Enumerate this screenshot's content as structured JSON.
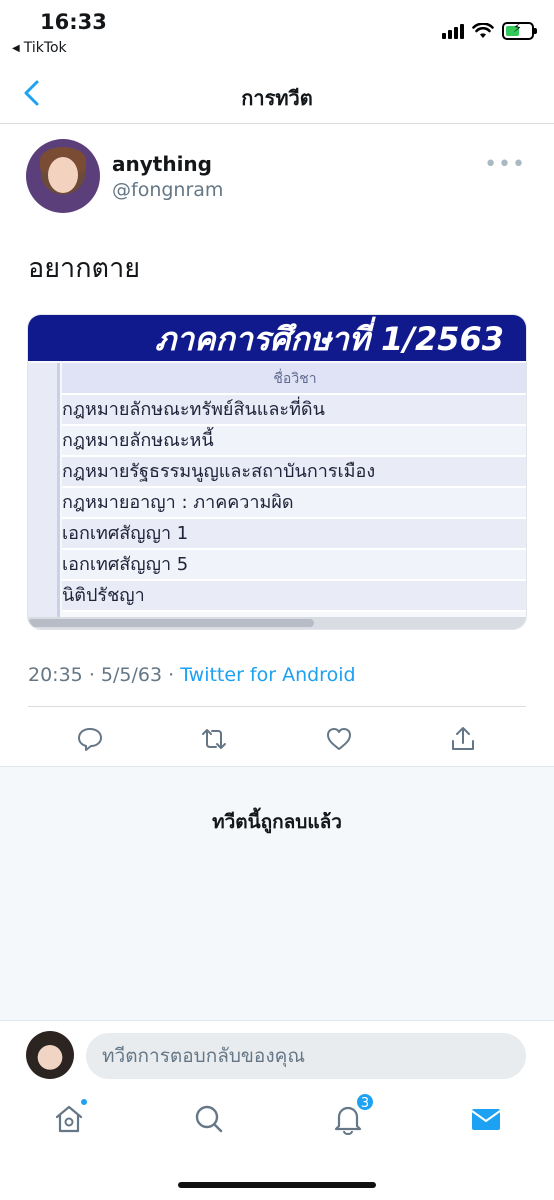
{
  "status_bar": {
    "time": "16:33",
    "back_app": "TikTok",
    "icons": [
      "cellular-signal-icon",
      "wifi-icon",
      "battery-charging-icon"
    ]
  },
  "header": {
    "title": "การทวีต",
    "back_icon": "chevron-left-icon"
  },
  "tweet": {
    "display_name": "anything",
    "handle": "@fongnram",
    "more_icon": "more-dots-icon",
    "text": "อยากตาย",
    "image": {
      "banner": "ภาคการศึกษาที่ 1/2563",
      "column_header": "ชื่อวิชา",
      "rows": [
        "กฎหมายลักษณะทรัพย์สินและที่ดิน",
        "กฎหมายลักษณะหนี้",
        "กฎหมายรัฐธรรมนูญและสถาบันการเมือง",
        "กฎหมายอาญา : ภาคความผิด",
        "เอกเทศสัญญา 1",
        "เอกเทศสัญญา 5",
        "นิติปรัชญา"
      ]
    },
    "time": "20:35",
    "date": "5/5/63",
    "separator": "·",
    "source": "Twitter for Android",
    "actions": [
      "reply-icon",
      "retweet-icon",
      "like-icon",
      "share-icon"
    ]
  },
  "deleted_notice": "ทวีตนี้ถูกลบแล้ว",
  "reply": {
    "placeholder": "ทวีตการตอบกลับของคุณ"
  },
  "tabbar": {
    "items": [
      "home-icon",
      "search-icon",
      "notifications-icon",
      "messages-icon"
    ],
    "notification_count": "3"
  },
  "colors": {
    "accent": "#1da1f2",
    "banner": "#111a8c"
  }
}
